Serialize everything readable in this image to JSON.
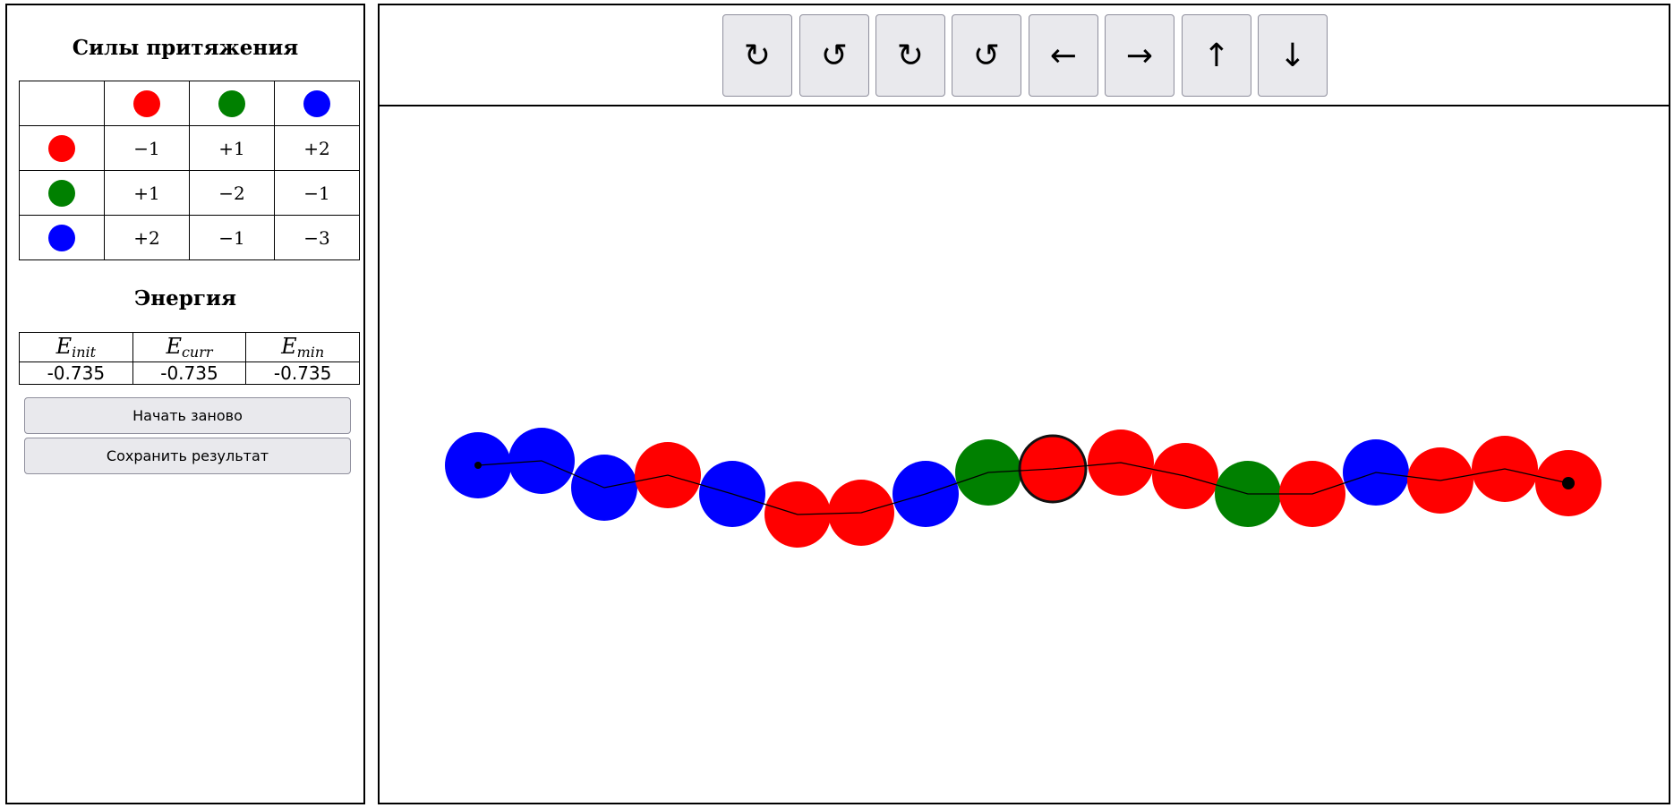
{
  "forces": {
    "title": "Силы притяжения",
    "colors": [
      "#ff0000",
      "#008000",
      "#0000ff"
    ],
    "rows": [
      [
        "−1",
        "+1",
        "+2"
      ],
      [
        "+1",
        "−2",
        "−1"
      ],
      [
        "+2",
        "−1",
        "−3"
      ]
    ]
  },
  "energy": {
    "title": "Энергия",
    "headers": [
      {
        "base": "E",
        "sub": "init"
      },
      {
        "base": "E",
        "sub": "curr"
      },
      {
        "base": "E",
        "sub": "min"
      }
    ],
    "values": [
      "-0.735",
      "-0.735",
      "-0.735"
    ]
  },
  "buttons": {
    "restart": "Начать заново",
    "save": "Сохранить результат"
  },
  "toolbar": [
    {
      "name": "rotate-cw-1-button",
      "icon": "↻"
    },
    {
      "name": "rotate-ccw-1-button",
      "icon": "↺"
    },
    {
      "name": "rotate-cw-2-button",
      "icon": "↻"
    },
    {
      "name": "rotate-ccw-2-button",
      "icon": "↺"
    },
    {
      "name": "move-left-button",
      "icon": "←"
    },
    {
      "name": "move-right-button",
      "icon": "→"
    },
    {
      "name": "move-up-button",
      "icon": "↑"
    },
    {
      "name": "move-down-button",
      "icon": "↓"
    }
  ],
  "chain": {
    "colors": {
      "R": "#ff0000",
      "G": "#008000",
      "B": "#0000ff"
    },
    "sequence": [
      "B",
      "B",
      "B",
      "R",
      "B",
      "R",
      "R",
      "B",
      "G",
      "R",
      "R",
      "R",
      "G",
      "R",
      "B",
      "R",
      "R",
      "R"
    ],
    "selected_index": 9
  }
}
